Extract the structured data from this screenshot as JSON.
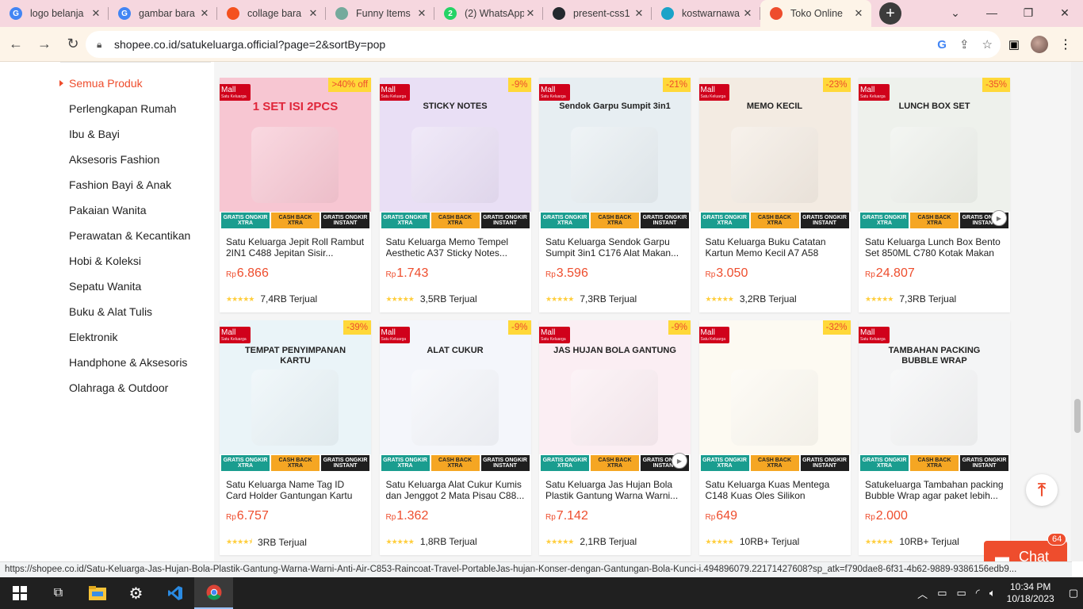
{
  "browser": {
    "tabs": [
      {
        "title": "logo belanja",
        "favicon": "google-icon",
        "color": "#4285f4",
        "letter": "G"
      },
      {
        "title": "gambar bara",
        "favicon": "google-icon",
        "color": "#4285f4",
        "letter": "G"
      },
      {
        "title": "collage bara",
        "favicon": "map-pin-icon",
        "color": "#f4511e",
        "letter": ""
      },
      {
        "title": "Funny Items",
        "favicon": "chatgpt-icon",
        "color": "#74aa9c",
        "letter": ""
      },
      {
        "title": "(2) WhatsApp",
        "favicon": "whatsapp-icon",
        "color": "#25d366",
        "letter": "2"
      },
      {
        "title": "present-css1",
        "favicon": "github-icon",
        "color": "#24292e",
        "letter": ""
      },
      {
        "title": "kostwarnawa",
        "favicon": "drop-icon",
        "color": "#1aa3c8",
        "letter": ""
      },
      {
        "title": "Toko Online",
        "favicon": "shopee-icon",
        "color": "#ee4d2d",
        "letter": ""
      }
    ],
    "url": "shopee.co.id/satukeluarga.official?page=2&sortBy=pop",
    "status_url": "https://shopee.co.id/Satu-Keluarga-Jas-Hujan-Bola-Plastik-Gantung-Warna-Warni-Anti-Air-C853-Raincoat-Travel-PortableJas-hujan-Konser-dengan-Gantungan-Bola-Kunci-i.494896079.22171427608?sp_atk=f790dae8-6f31-4b62-9889-9386156edb9..."
  },
  "sidebar": {
    "categories": [
      "Semua Produk",
      "Perlengkapan Rumah",
      "Ibu & Bayi",
      "Aksesoris Fashion",
      "Fashion Bayi & Anak",
      "Pakaian Wanita",
      "Perawatan & Kecantikan",
      "Hobi & Koleksi",
      "Sepatu Wanita",
      "Buku & Alat Tulis",
      "Elektronik",
      "Handphone & Aksesoris",
      "Olahraga & Outdoor"
    ]
  },
  "labels": {
    "mall": "Mall",
    "mall_sub": "Satu Keluarga",
    "currency": "Rp",
    "badge_gratis": "GRATIS ONGKIR XTRA",
    "badge_cashback": "CASH BACK XTRA",
    "badge_instant": "GRATIS ONGKIR INSTANT",
    "chat": "Chat",
    "chat_count": "64"
  },
  "products": [
    {
      "name": "Satu Keluarga Jepit Roll Rambut 2IN1 C488 Jepitan Sisir...",
      "price": "6.866",
      "discount": ">40% off",
      "rating": 5,
      "sold": "7,4RB Terjual",
      "image_text": "1 SET ISI 2PCS",
      "image_color": "#f7c6d2",
      "play": false
    },
    {
      "name": "Satu Keluarga Memo Tempel Aesthetic A37 Sticky Notes...",
      "price": "1.743",
      "discount": "-9%",
      "rating": 5,
      "sold": "3,5RB Terjual",
      "image_text": "STICKY NOTES",
      "image_color": "#e9dff5",
      "play": false
    },
    {
      "name": "Satu Keluarga Sendok Garpu Sumpit 3in1 C176 Alat Makan...",
      "price": "3.596",
      "discount": "-21%",
      "rating": 5,
      "sold": "7,3RB Terjual",
      "image_text": "Sendok Garpu Sumpit 3in1",
      "image_color": "#e7eef2",
      "play": false
    },
    {
      "name": "Satu Keluarga Buku Catatan Kartun Memo Kecil A7 A58 Buk...",
      "price": "3.050",
      "discount": "-23%",
      "rating": 5,
      "sold": "3,2RB Terjual",
      "image_text": "MEMO KECIL",
      "image_color": "#f3ebe2",
      "play": false
    },
    {
      "name": "Satu Keluarga Lunch Box Bento Set 850ML C780 Kotak Makan ...",
      "price": "24.807",
      "discount": "-35%",
      "rating": 5,
      "sold": "7,3RB Terjual",
      "image_text": "LUNCH BOX SET",
      "image_color": "#eef1ec",
      "play": true
    },
    {
      "name": "Satu Keluarga Name Tag ID Card Holder Gantungan Kartu Nama...",
      "price": "6.757",
      "discount": "-39%",
      "rating": 4.5,
      "sold": "3RB Terjual",
      "image_text": "TEMPAT PENYIMPANAN KARTU",
      "image_color": "#eaf4f8",
      "play": false
    },
    {
      "name": "Satu Keluarga Alat Cukur Kumis dan Jenggot 2 Mata Pisau C88...",
      "price": "1.362",
      "discount": "-9%",
      "rating": 5,
      "sold": "1,8RB Terjual",
      "image_text": "ALAT CUKUR",
      "image_color": "#f4f6fb",
      "play": false
    },
    {
      "name": "Satu Keluarga Jas Hujan Bola Plastik Gantung Warna Warni...",
      "price": "7.142",
      "discount": "-9%",
      "rating": 5,
      "sold": "2,1RB Terjual",
      "image_text": "JAS HUJAN BOLA GANTUNG",
      "image_color": "#fbeef3",
      "play": true
    },
    {
      "name": "Satu Keluarga Kuas Mentega C148 Kuas Oles Silikon Minyak...",
      "price": "649",
      "discount": "-32%",
      "rating": 5,
      "sold": "10RB+ Terjual",
      "image_text": "",
      "image_color": "#fdfaf2",
      "play": false
    },
    {
      "name": "Satukeluarga Tambahan packing Bubble Wrap agar paket lebih...",
      "price": "2.000",
      "discount": "",
      "rating": 5,
      "sold": "10RB+ Terjual",
      "image_text": "TAMBAHAN PACKING BUBBLE WRAP",
      "image_color": "#f4f5f6",
      "play": false
    }
  ],
  "taskbar": {
    "time": "10:34 PM",
    "date": "10/18/2023"
  }
}
